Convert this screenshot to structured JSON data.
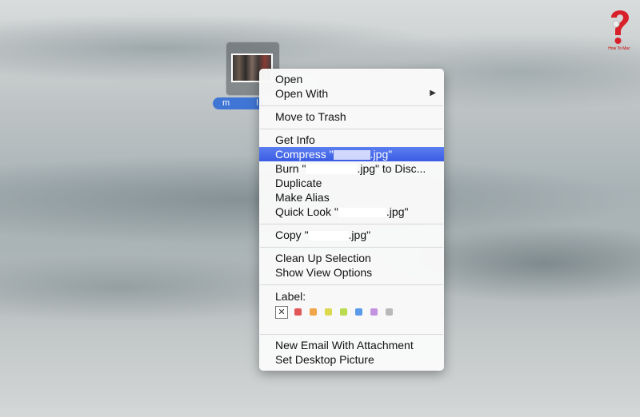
{
  "desktop": {
    "file": {
      "name_visible_start": "m",
      "name_visible_end": "l"
    },
    "logo": {
      "text": "How To Mac",
      "icon": "question-mark-icon"
    }
  },
  "menu": {
    "items": [
      {
        "label": "Open"
      },
      {
        "label": "Open With",
        "submenu": true,
        "arrow": "▶"
      },
      {
        "label": "Move to Trash"
      },
      {
        "label": "Get Info"
      },
      {
        "label_pre": "Compress \"",
        "label_post": ".jpg\"",
        "highlighted": true
      },
      {
        "label_pre": "Burn \"",
        "label_post": ".jpg\" to Disc..."
      },
      {
        "label": "Duplicate"
      },
      {
        "label": "Make Alias"
      },
      {
        "label_pre": "Quick Look \"",
        "label_post": ".jpg\""
      },
      {
        "label_pre": "Copy \"",
        "label_post": ".jpg\""
      },
      {
        "label": "Clean Up Selection"
      },
      {
        "label": "Show View Options"
      },
      {
        "label": "Label:"
      },
      {
        "label": "New Email With Attachment"
      },
      {
        "label": "Set Desktop Picture"
      }
    ],
    "label_none": "✕",
    "label_colors": [
      "#e0575a",
      "#f0a548",
      "#dcd94f",
      "#b9dc4f",
      "#5a9ae8",
      "#c493e0",
      "#b9b9b9"
    ]
  }
}
